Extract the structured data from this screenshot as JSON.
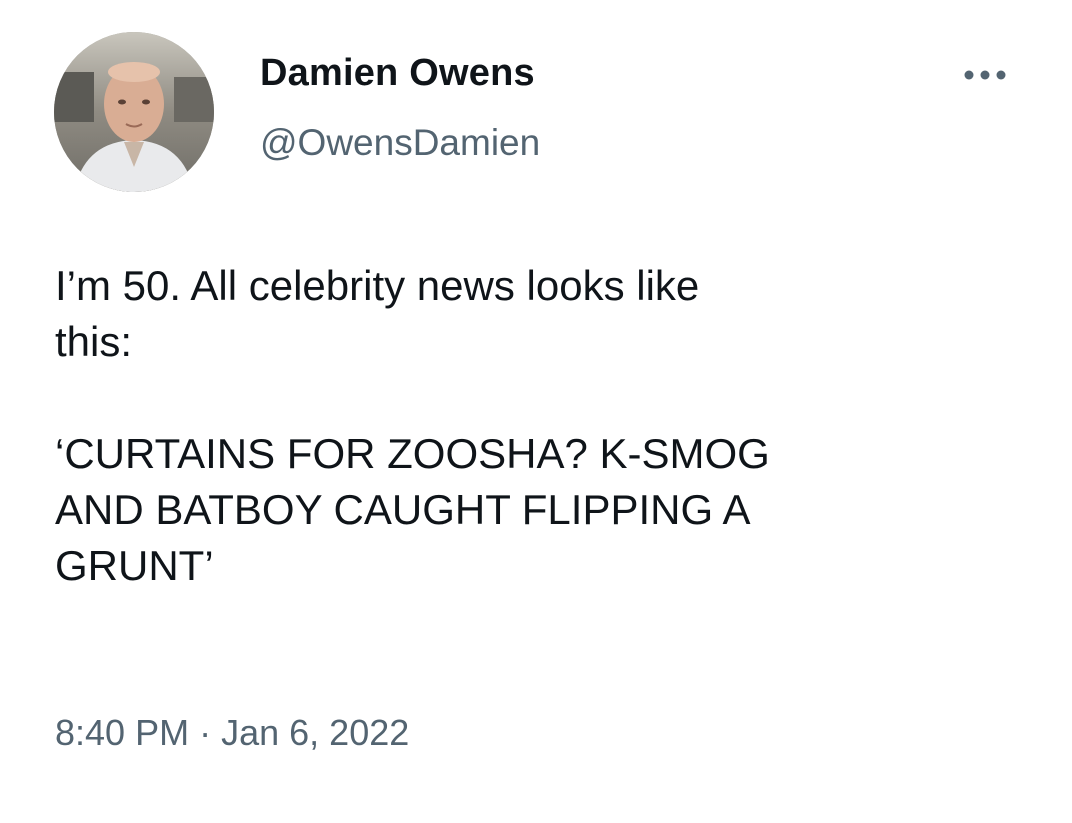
{
  "author": {
    "display_name": "Damien Owens",
    "handle": "@OwensDamien"
  },
  "more_icon": "ellipsis-icon",
  "tweet": {
    "line1": "I’m 50. All celebrity news looks like",
    "line2": "this:",
    "line3": "‘CURTAINS FOR ZOOSHA? K-SMOG",
    "line4": "AND BATBOY CAUGHT FLIPPING A",
    "line5": "GRUNT’"
  },
  "meta": {
    "time": "8:40 PM",
    "separator": "·",
    "date": "Jan 6, 2022"
  },
  "colors": {
    "text": "#0f1419",
    "secondary": "#536471",
    "background": "#ffffff"
  }
}
